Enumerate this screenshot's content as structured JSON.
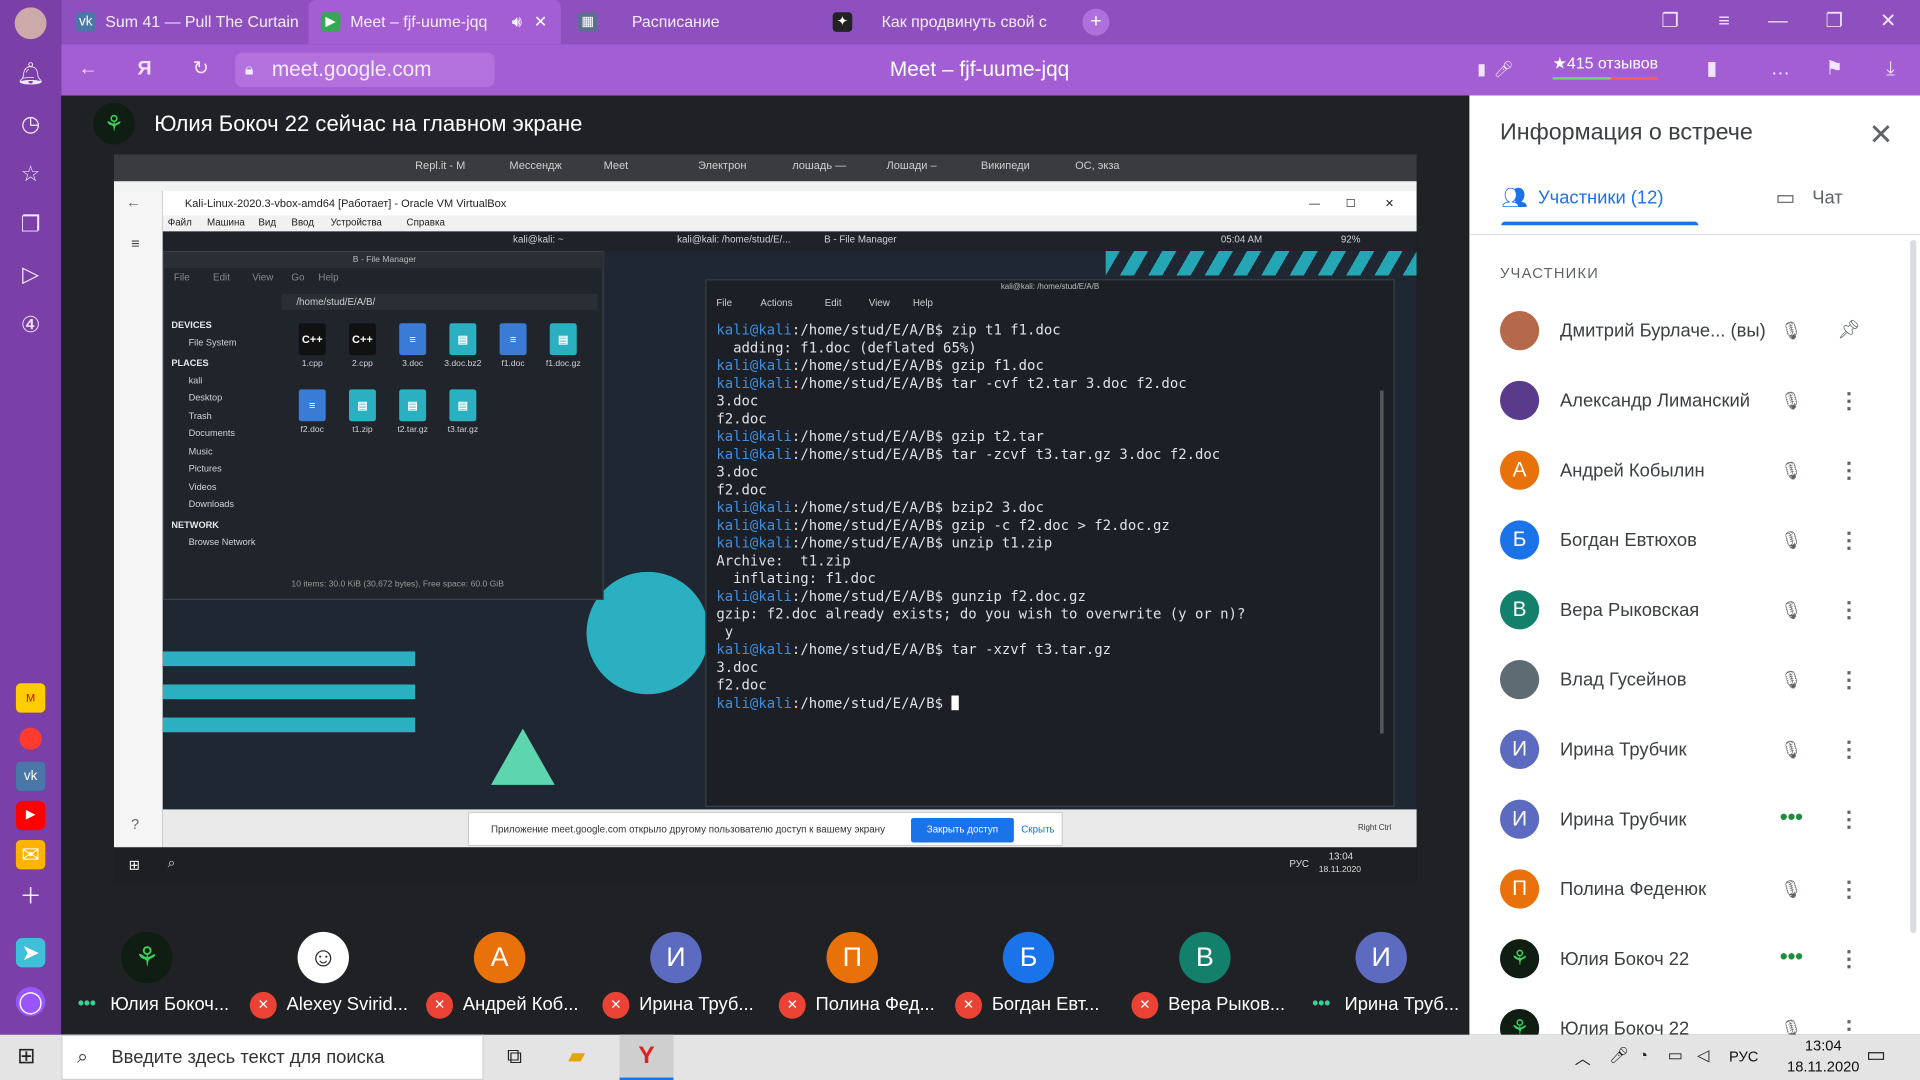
{
  "browser": {
    "tabs": [
      {
        "label": "Sum 41 — Pull The Curtain",
        "icon": "vk-icon"
      },
      {
        "label": "Meet – fjf-uume-jqq",
        "icon": "meet-icon"
      },
      {
        "label": "Расписание",
        "icon": "calendar-icon"
      },
      {
        "label": "Как продвинуть свой с",
        "icon": "rocket-icon"
      }
    ],
    "url": "meet.google.com",
    "page_title": "Meet – fjf-uume-jqq",
    "reviews": "★415 отзывов"
  },
  "meet": {
    "presenter_banner": "Юлия Бокоч 22 сейчас на главном экране",
    "shared_screen": {
      "inner_tabs": [
        "Repl.it - M",
        "Мессендж",
        "Meet",
        "Электрон",
        "лошадь —",
        "Лошади –",
        "Википеди",
        "ОС, экза"
      ],
      "vbox_title": "Kali-Linux-2020.3-vbox-amd64 [Работает] - Oracle VM VirtualBox",
      "vbox_menu": [
        "Файл",
        "Машина",
        "Вид",
        "Ввод",
        "Устройства",
        "Справка"
      ],
      "xfce_tasks": [
        "kali@kali: ~",
        "kali@kali: /home/stud/E/...",
        "B - File Manager"
      ],
      "xfce_time": "05:04 AM",
      "xfce_battery": "92%",
      "file_manager": {
        "title": "B - File Manager",
        "menu": [
          "File",
          "Edit",
          "View",
          "Go",
          "Help"
        ],
        "path": "/home/stud/E/A/B/",
        "sections": {
          "devices": "DEVICES",
          "places": "PLACES",
          "network": "NETWORK"
        },
        "devices": [
          "File System"
        ],
        "places": [
          "kali",
          "Desktop",
          "Trash",
          "Documents",
          "Music",
          "Pictures",
          "Videos",
          "Downloads"
        ],
        "network": [
          "Browse Network"
        ],
        "files": [
          "1.cpp",
          "2.cpp",
          "3.doc",
          "3.doc.bz2",
          "f1.doc",
          "f1.doc.gz",
          "f2.doc",
          "t1.zip",
          "t2.tar.gz",
          "t3.tar.gz"
        ],
        "status": "10 items: 30.0 KiB (30,672 bytes), Free space: 60.0 GiB"
      },
      "terminal": {
        "title": "kali@kali: /home/stud/E/A/B",
        "menu": [
          "File",
          "Actions",
          "Edit",
          "View",
          "Help"
        ],
        "lines": [
          {
            "p": true,
            "t": "zip t1 f1.doc"
          },
          {
            "p": false,
            "t": "  adding: f1.doc (deflated 65%)"
          },
          {
            "p": true,
            "t": "gzip f1.doc"
          },
          {
            "p": true,
            "t": "tar -cvf t2.tar 3.doc f2.doc"
          },
          {
            "p": false,
            "t": "3.doc"
          },
          {
            "p": false,
            "t": "f2.doc"
          },
          {
            "p": true,
            "t": "gzip t2.tar"
          },
          {
            "p": true,
            "t": "tar -zcvf t3.tar.gz 3.doc f2.doc"
          },
          {
            "p": false,
            "t": "3.doc"
          },
          {
            "p": false,
            "t": "f2.doc"
          },
          {
            "p": true,
            "t": "bzip2 3.doc"
          },
          {
            "p": true,
            "t": "gzip -c f2.doc > f2.doc.gz"
          },
          {
            "p": true,
            "t": "unzip t1.zip"
          },
          {
            "p": false,
            "t": "Archive:  t1.zip"
          },
          {
            "p": false,
            "t": "  inflating: f1.doc"
          },
          {
            "p": true,
            "t": "gunzip f2.doc.gz"
          },
          {
            "p": false,
            "t": "gzip: f2.doc already exists; do you wish to overwrite (y or n)?"
          },
          {
            "p": false,
            "t": " y"
          },
          {
            "p": true,
            "t": "tar -xzvf t3.tar.gz"
          },
          {
            "p": false,
            "t": "3.doc"
          },
          {
            "p": false,
            "t": "f2.doc"
          },
          {
            "p": true,
            "t": ""
          }
        ],
        "prompt_user": "kali@kali",
        "prompt_path": ":/home/stud/E/A/B$ "
      },
      "share_notice": {
        "text": "Приложение meet.google.com открыло другому пользователю доступ к вашему экрану",
        "share_button": "Закрыть доступ",
        "hide_link": "Скрыть"
      },
      "vbox_host_key": "Right Ctrl",
      "inner_taskbar": {
        "lang": "РУС",
        "time": "13:04",
        "date": "18.11.2020"
      }
    },
    "tiles": [
      {
        "name": "Юлия Бокоч...",
        "initial": "",
        "color": "#0f1d12",
        "status": "speaking"
      },
      {
        "name": "Alexey Svirid...",
        "initial": "",
        "color": "#ffffff",
        "status": "muted"
      },
      {
        "name": "Андрей Коб...",
        "initial": "А",
        "color": "#e8710a",
        "status": "muted"
      },
      {
        "name": "Ирина Труб...",
        "initial": "И",
        "color": "#5c6bc0",
        "status": "muted"
      },
      {
        "name": "Полина Фед...",
        "initial": "П",
        "color": "#e8710a",
        "status": "muted"
      },
      {
        "name": "Богдан Евт...",
        "initial": "Б",
        "color": "#1a73e8",
        "status": "muted"
      },
      {
        "name": "Вера Рыков...",
        "initial": "В",
        "color": "#12806b",
        "status": "muted"
      },
      {
        "name": "Ирина Труб...",
        "initial": "И",
        "color": "#5c6bc0",
        "status": "speaking"
      }
    ]
  },
  "panel": {
    "title": "Информация о встрече",
    "tab_people": "Участники (12)",
    "tab_chat": "Чат",
    "section_label": "УЧАСТНИКИ",
    "participants": [
      {
        "name": "Дмитрий Бурлаче...  (вы)",
        "initial": "",
        "color": "#b5694a",
        "mic": "muted",
        "action": "pin"
      },
      {
        "name": "Александр Лиманский",
        "initial": "",
        "color": "#5a3a8a",
        "mic": "muted",
        "action": "more"
      },
      {
        "name": "Андрей Кобылин",
        "initial": "А",
        "color": "#e8710a",
        "mic": "muted",
        "action": "more"
      },
      {
        "name": "Богдан Евтюхов",
        "initial": "Б",
        "color": "#1a73e8",
        "mic": "muted",
        "action": "more"
      },
      {
        "name": "Вера Рыковская",
        "initial": "В",
        "color": "#12806b",
        "mic": "muted",
        "action": "more"
      },
      {
        "name": "Влад Гусейнов",
        "initial": "",
        "color": "#5e6b73",
        "mic": "muted",
        "action": "more"
      },
      {
        "name": "Ирина Трубчик",
        "initial": "И",
        "color": "#5c6bc0",
        "mic": "muted",
        "action": "more"
      },
      {
        "name": "Ирина Трубчик",
        "initial": "И",
        "color": "#5c6bc0",
        "mic": "active",
        "action": "more"
      },
      {
        "name": "Полина Феденюк",
        "initial": "П",
        "color": "#e8710a",
        "mic": "muted",
        "action": "more"
      },
      {
        "name": "Юлия Бокоч 22",
        "initial": "",
        "color": "#0f1d12",
        "mic": "active",
        "action": "more"
      },
      {
        "name": "Юлия Бокоч 22",
        "initial": "",
        "color": "#0f1d12",
        "mic": "muted",
        "action": "more"
      }
    ]
  },
  "taskbar": {
    "search_placeholder": "Введите здесь текст для поиска",
    "lang": "РУС",
    "time": "13:04",
    "date": "18.11.2020"
  }
}
